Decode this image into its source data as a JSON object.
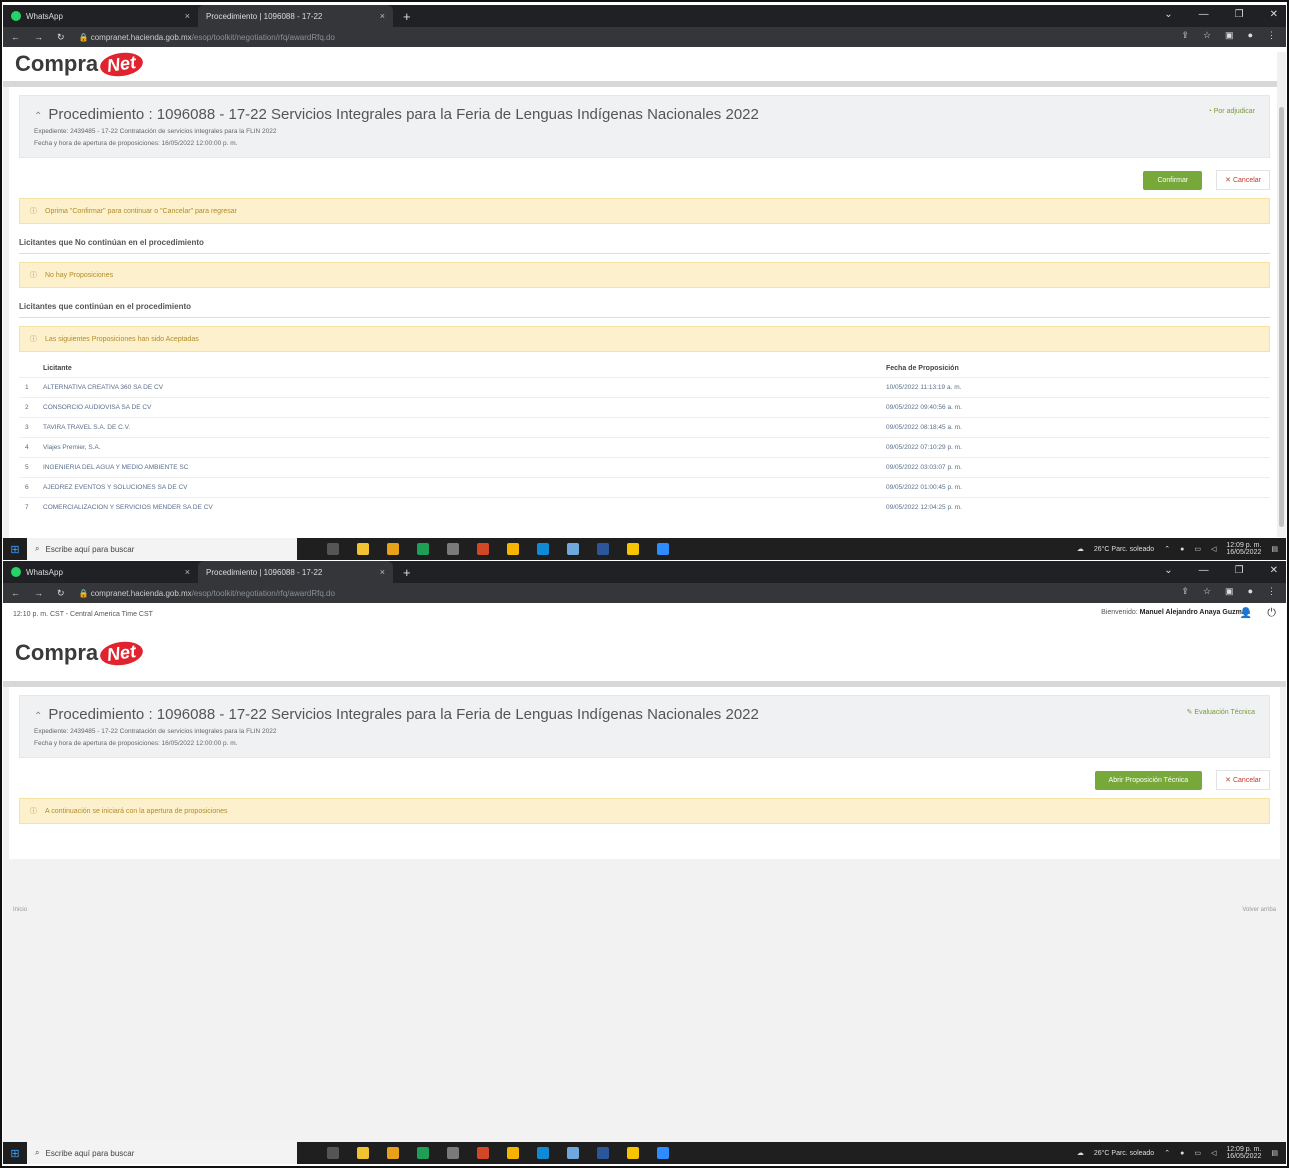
{
  "browser": {
    "tab_whatsapp": "WhatsApp",
    "tab_active": "Procedimiento | 1096088 - 17-22",
    "tab_close": "×",
    "new_tab": "+",
    "url_host": "compranet.hacienda.gob.mx",
    "url_path": "/esop/toolkit/negotiation/rfq/awardRfq.do"
  },
  "header": {
    "time_zone": "12:10 p. m. CST - Central America Time CST",
    "welcome": "Bienvenido:",
    "user_name": "Manuel Alejandro Anaya Guzmán"
  },
  "logo": {
    "compra": "Compra",
    "net": "Net"
  },
  "procedure": {
    "title": "Procedimiento : 1096088 - 17-22 Servicios Integrales para la Feria de Lenguas Indígenas Nacionales 2022",
    "expediente": "Expediente: 2439485 - 17-22 Contratación de servicios integrales para la FLIN 2022",
    "fecha_apertura": "Fecha y hora de apertura de proposiciones: 16/05/2022 12:00:00 p. m."
  },
  "screen1": {
    "status": "Por adjudicar",
    "confirm_label": "Confirmar",
    "cancel_label": "Cancelar",
    "alert_confirm": "Oprima \"Confirmar\" para continuar o \"Cancelar\" para regresar",
    "section_no_continuan": "Licitantes que No continúan en el procedimiento",
    "alert_no_props": "No hay Proposiciones",
    "section_continuan": "Licitantes que continúan en el procedimiento",
    "alert_aceptadas": "Las siguientes Proposiciones han sido Aceptadas",
    "col_licitante": "Licitante",
    "col_fecha": "Fecha de Proposición",
    "rows": [
      {
        "n": "1",
        "name": "ALTERNATIVA CREATIVA 360 SA DE CV",
        "date": "10/05/2022 11:13:19 a. m."
      },
      {
        "n": "2",
        "name": "CONSORCIO AUDIOVISA SA DE CV",
        "date": "09/05/2022 09:40:56 a. m."
      },
      {
        "n": "3",
        "name": "TAVIRA TRAVEL S.A. DE C.V.",
        "date": "09/05/2022 08:18:45 a. m."
      },
      {
        "n": "4",
        "name": "Viajes Premier, S.A.",
        "date": "09/05/2022 07:10:29 p. m."
      },
      {
        "n": "5",
        "name": "INGENIERIA DEL AGUA Y MEDIO AMBIENTE SC",
        "date": "09/05/2022 03:03:07 p. m."
      },
      {
        "n": "6",
        "name": "AJEDREZ EVENTOS Y SOLUCIONES SA DE CV",
        "date": "09/05/2022 01:00:45 p. m."
      },
      {
        "n": "7",
        "name": "COMERCIALIZACION Y SERVICIOS MENDER SA DE CV",
        "date": "09/05/2022 12:04:25 p. m."
      }
    ]
  },
  "screen2": {
    "status": "Evaluación Técnica",
    "open_label": "Abrir Proposición Técnica",
    "cancel_label": "Cancelar",
    "alert_apertura": "A continuación se iniciará con la apertura de proposiciones",
    "footer_left": "Inicio",
    "footer_right": "Volver arriba"
  },
  "taskbar": {
    "search_placeholder": "Escribe aquí para buscar",
    "weather": "26°C Parc. soleado",
    "clock_time": "12:09 p. m.",
    "clock_date": "16/05/2022",
    "lang": "ESP"
  },
  "colors": {
    "accent_green": "#77a83a",
    "alert_bg": "#fcf1cc",
    "compranet_red": "#e0232e"
  }
}
